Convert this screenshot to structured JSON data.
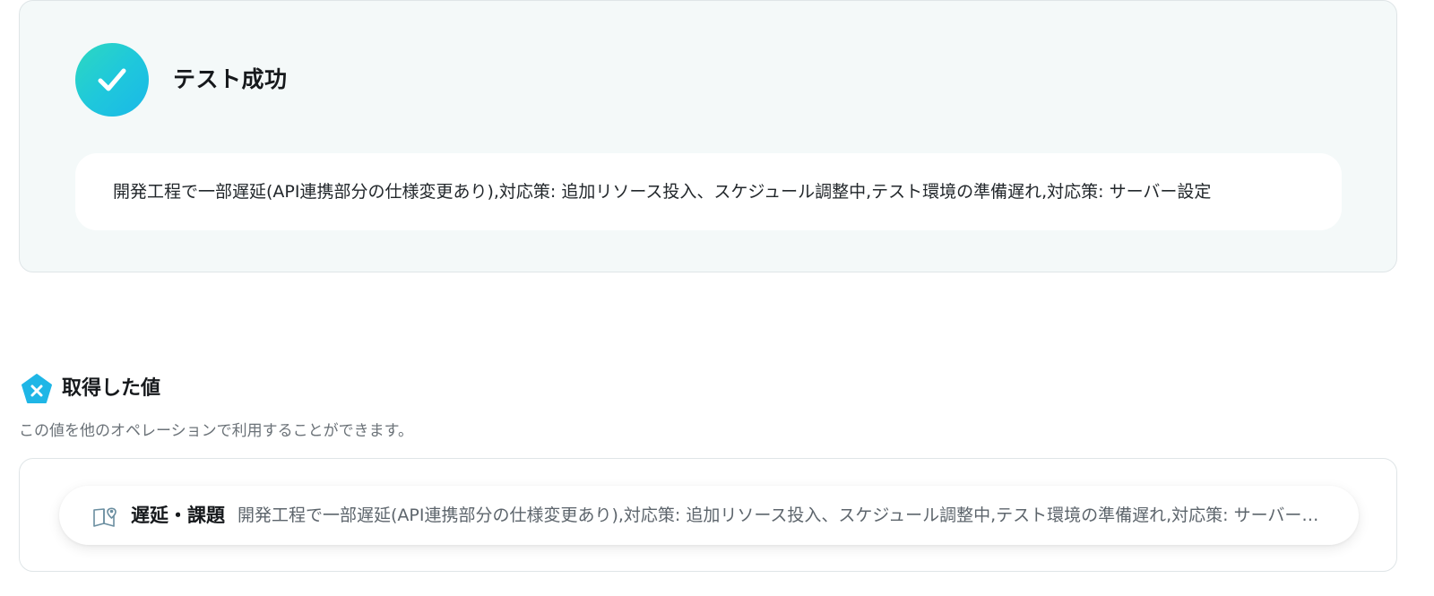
{
  "test_result": {
    "status_title": "テスト成功",
    "output_text": "開発工程で一部遅延(API連携部分の仕様変更あり),対応策: 追加リソース投入、スケジュール調整中,テスト環境の準備遅れ,対応策: サーバー設定"
  },
  "retrieved_values": {
    "title": "取得した値",
    "description": "この値を他のオペレーションで利用することができます。",
    "items": [
      {
        "label": "遅延・課題",
        "value": "開発工程で一部遅延(API連携部分の仕様変更あり),対応策: 追加リソース投入、スケジュール調整中,テスト環境の準備遅れ,対応策: サーバー設定"
      }
    ]
  },
  "colors": {
    "success_gradient_start": "#2dd8c0",
    "success_gradient_end": "#1ab8e8",
    "card_background": "#f4f9f9",
    "section_icon": "#1fb6e6"
  },
  "icons": {
    "success": "checkmark-icon",
    "section": "variable-icon",
    "chip": "book-pin-icon"
  }
}
